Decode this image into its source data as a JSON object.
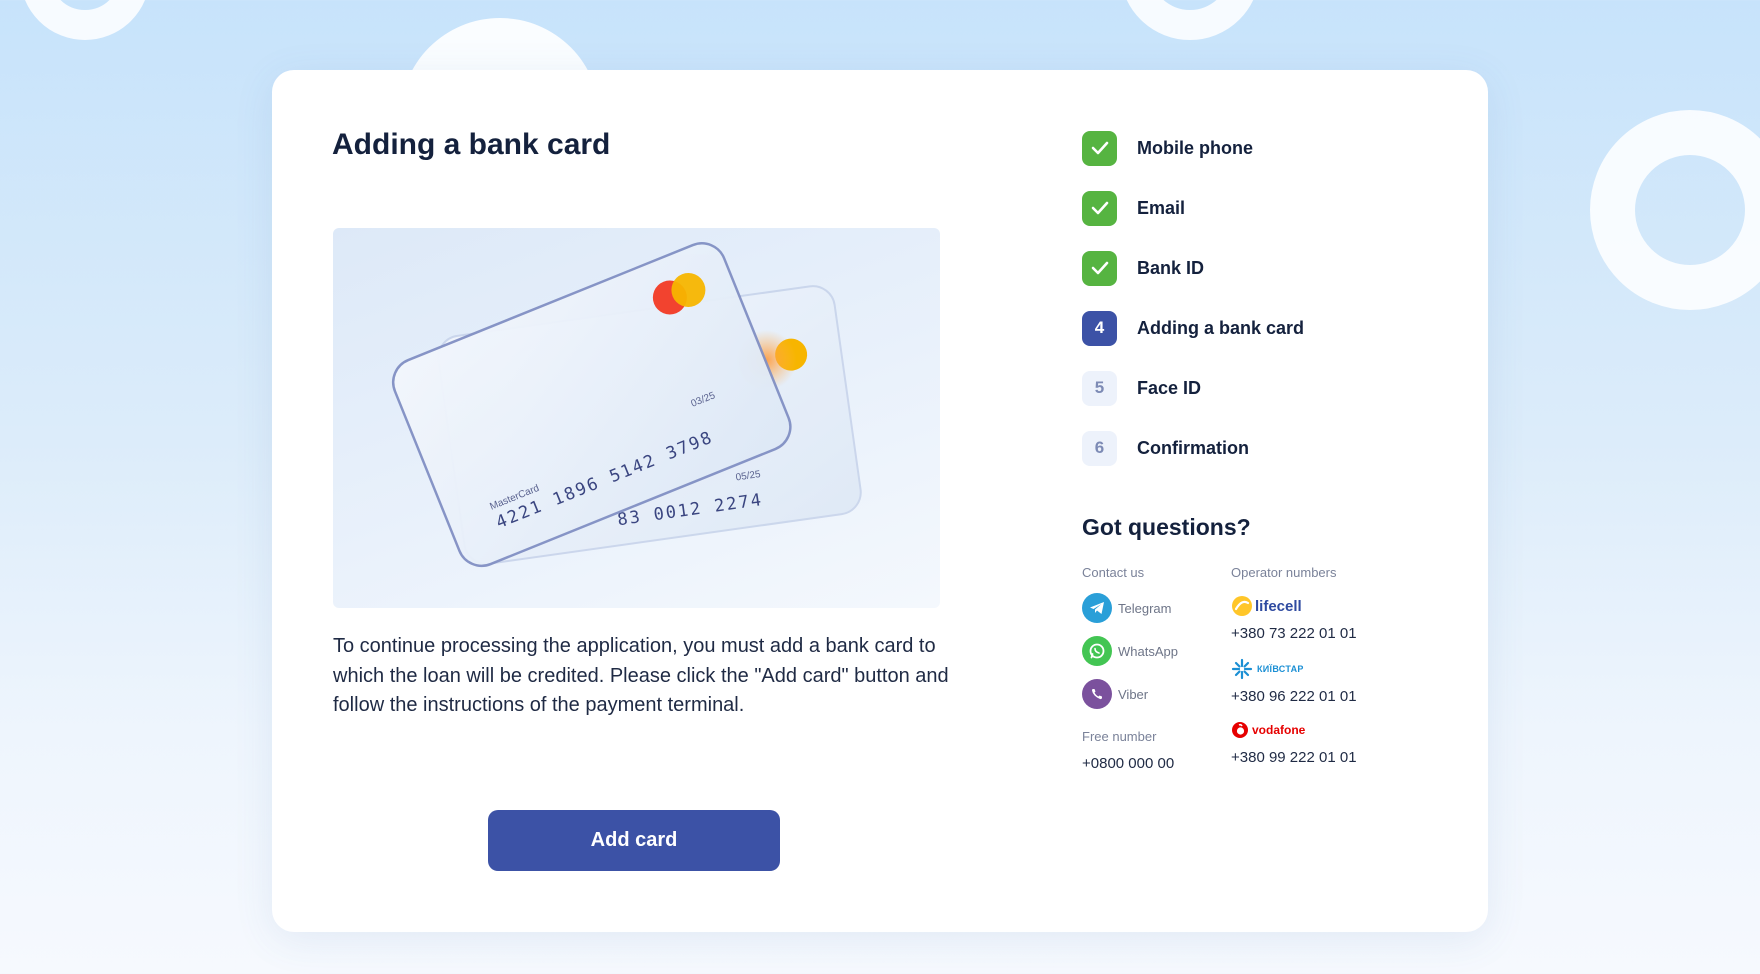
{
  "page": {
    "title": "Adding a bank card",
    "description": "To continue processing the application, you must add a bank card to which the loan will be credited. Please click the \"Add card\" button and follow the instructions of the payment terminal.",
    "add_card_button": "Add card"
  },
  "card_illustration": {
    "front": {
      "brand": "MasterCard",
      "number": "4221 1896 5142 3798",
      "expiry": "03/25"
    },
    "back": {
      "number_partial": "83 0012 2274",
      "expiry": "05/25"
    }
  },
  "steps": [
    {
      "number": "1",
      "label": "Mobile phone",
      "status": "done"
    },
    {
      "number": "2",
      "label": "Email",
      "status": "done"
    },
    {
      "number": "3",
      "label": "Bank ID",
      "status": "done"
    },
    {
      "number": "4",
      "label": "Adding a bank card",
      "status": "current"
    },
    {
      "number": "5",
      "label": "Face ID",
      "status": "pending"
    },
    {
      "number": "6",
      "label": "Confirmation",
      "status": "pending"
    }
  ],
  "questions": {
    "title": "Got questions?",
    "contact_heading": "Contact us",
    "contacts": [
      {
        "label": "Telegram",
        "icon": "telegram-icon",
        "color": "#2a9fd8"
      },
      {
        "label": "WhatsApp",
        "icon": "whatsapp-icon",
        "color": "#43c553"
      },
      {
        "label": "Viber",
        "icon": "viber-icon",
        "color": "#7b519d"
      }
    ],
    "free_heading": "Free number",
    "free_number": "+0800 000 00",
    "operator_heading": "Operator numbers",
    "operators": [
      {
        "name": "lifecell",
        "number": "+380 73 222 01 01"
      },
      {
        "name": "КИЇВСТАР",
        "number": "+380 96 222 01 01"
      },
      {
        "name": "vodafone",
        "number": "+380 99 222 01 01"
      }
    ]
  },
  "colors": {
    "accent": "#3c52a6",
    "done": "#56b441",
    "title": "#14213d",
    "background": "#c7e3fb"
  }
}
